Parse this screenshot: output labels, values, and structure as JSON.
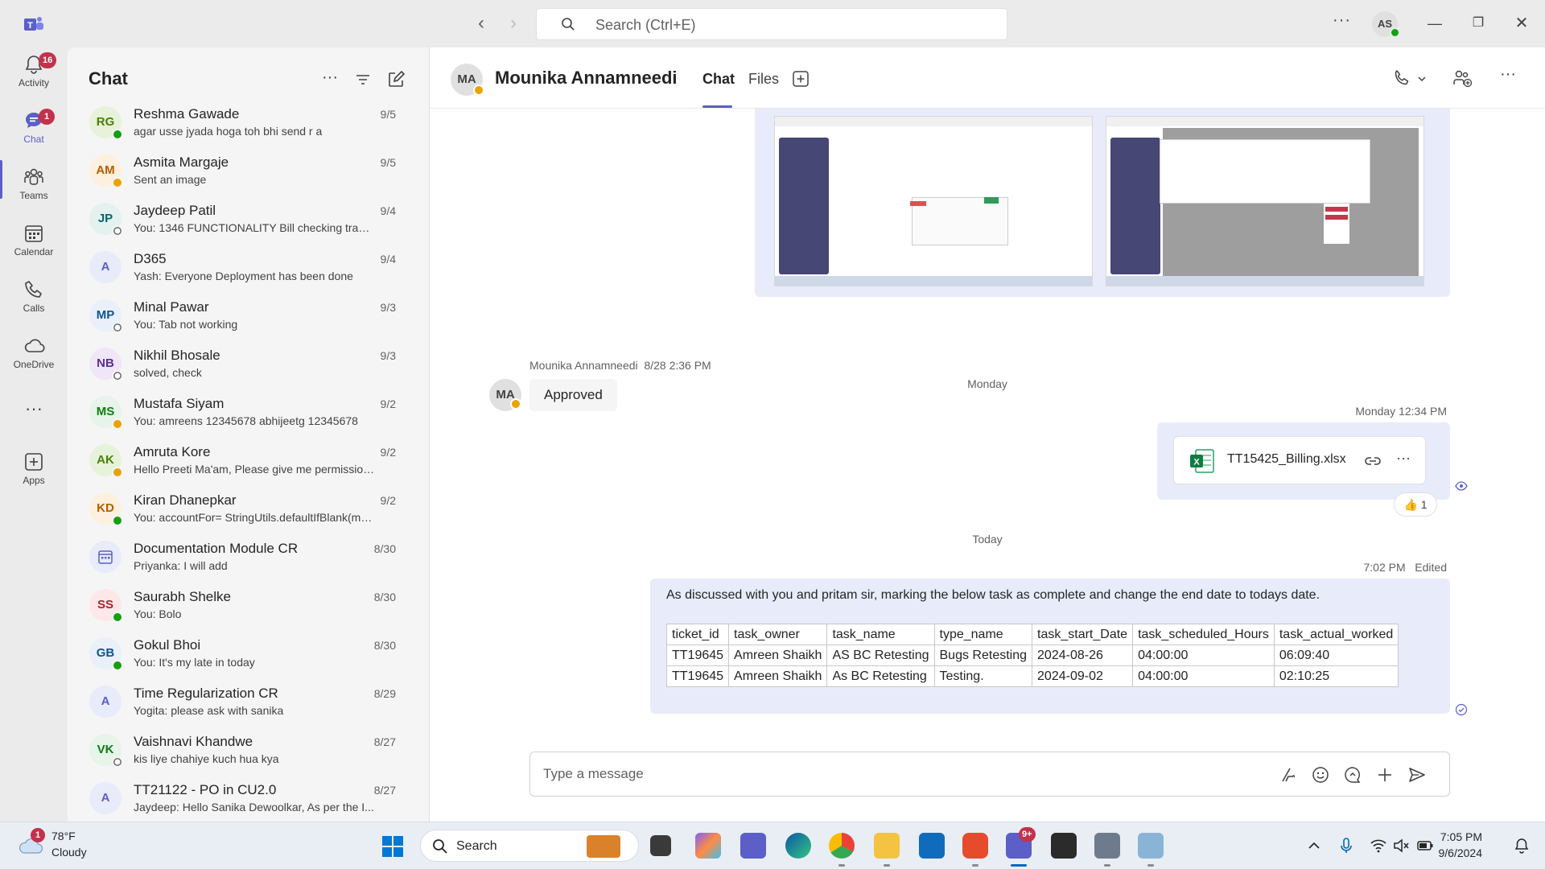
{
  "window": {
    "search_placeholder": "Search (Ctrl+E)",
    "user_initials": "AS"
  },
  "rail": {
    "items": [
      {
        "label": "Activity",
        "badge": "16"
      },
      {
        "label": "Chat",
        "badge": "1"
      },
      {
        "label": "Teams"
      },
      {
        "label": "Calendar"
      },
      {
        "label": "Calls"
      },
      {
        "label": "OneDrive"
      },
      {
        "label": "Apps"
      }
    ]
  },
  "chat_list": {
    "heading": "Chat",
    "items": [
      {
        "initials": "RG",
        "name": "Reshma Gawade",
        "preview": "agar usse jyada hoga toh bhi send r a",
        "date": "9/5",
        "status": "available"
      },
      {
        "initials": "AM",
        "name": "Asmita Margaje",
        "preview": "Sent an image",
        "date": "9/5",
        "status": "away"
      },
      {
        "initials": "JP",
        "name": "Jaydeep Patil",
        "preview": "You: 1346 FUNCTIONALITY Bill checking transa...",
        "date": "9/4",
        "status": "offline"
      },
      {
        "initials": "A",
        "name": "D365",
        "preview": "Yash: Everyone Deployment has been done",
        "date": "9/4",
        "status": "group"
      },
      {
        "initials": "MP",
        "name": "Minal Pawar",
        "preview": "You: Tab not working",
        "date": "9/3",
        "status": "offline"
      },
      {
        "initials": "NB",
        "name": "Nikhil Bhosale",
        "preview": "solved, check",
        "date": "9/3",
        "status": "offline"
      },
      {
        "initials": "MS",
        "name": "Mustafa Siyam",
        "preview": "You: amreens 12345678 abhijeetg 12345678",
        "date": "9/2",
        "status": "away"
      },
      {
        "initials": "AK",
        "name": "Amruta Kore",
        "preview": "Hello Preeti Ma'am, Please give me permission ...",
        "date": "9/2",
        "status": "away"
      },
      {
        "initials": "KD",
        "name": "Kiran Dhanepkar",
        "preview": "You: accountFor=  StringUtils.defaultIfBlank(ma...",
        "date": "9/2",
        "status": "available"
      },
      {
        "initials": "",
        "name": "Documentation Module CR",
        "preview": "Priyanka: I will add",
        "date": "8/30",
        "status": "meeting"
      },
      {
        "initials": "SS",
        "name": "Saurabh Shelke",
        "preview": "You: Bolo",
        "date": "8/30",
        "status": "available"
      },
      {
        "initials": "GB",
        "name": "Gokul Bhoi",
        "preview": "You: It's my late in today",
        "date": "8/30",
        "status": "available"
      },
      {
        "initials": "A",
        "name": "Time Regularization CR",
        "preview": "Yogita: please ask with sanika",
        "date": "8/29",
        "status": "group"
      },
      {
        "initials": "VK",
        "name": "Vaishnavi Khandwe",
        "preview": "kis liye chahiye kuch hua kya",
        "date": "8/27",
        "status": "offline"
      },
      {
        "initials": "A",
        "name": "TT21122 - PO in CU2.0",
        "preview": "Jaydeep: Hello Sanika Dewoolkar,   As per the I...",
        "date": "8/27",
        "status": "group"
      }
    ]
  },
  "conversation": {
    "initials": "MA",
    "name": "Mounika Annamneedi",
    "tabs": {
      "chat": "Chat",
      "files": "Files"
    },
    "msg1": {
      "sender": "Mounika Annamneedi",
      "time": "8/28 2:36 PM",
      "text": "Approved"
    },
    "day1": "Monday",
    "msg2": {
      "time": "Monday 12:34 PM",
      "file_name": "TT15425_Billing.xlsx",
      "reaction_count": "1"
    },
    "day2": "Today",
    "msg3": {
      "time": "7:02 PM",
      "edited": "Edited",
      "text": "As discussed with you and pritam sir, marking the below task as complete and change the end date to todays date.",
      "table": {
        "headers": [
          "ticket_id",
          "task_owner",
          "task_name",
          "type_name",
          "task_start_Date",
          "task_scheduled_Hours",
          "task_actual_worked"
        ],
        "rows": [
          [
            "TT19645",
            "Amreen Shaikh",
            "AS BC Retesting",
            "Bugs Retesting",
            "2024-08-26",
            "04:00:00",
            "06:09:40"
          ],
          [
            "TT19645",
            "Amreen Shaikh",
            "As BC Retesting",
            "Testing.",
            "2024-09-02",
            "04:00:00",
            "02:10:25"
          ]
        ]
      }
    },
    "compose_placeholder": "Type a message"
  },
  "taskbar": {
    "weather_temp": "78°F",
    "weather_cond": "Cloudy",
    "weather_badge": "1",
    "search_label": "Search",
    "teams_badge": "9+",
    "time": "7:05 PM",
    "date": "9/6/2024"
  },
  "colors": {
    "accent": "#5b5fc7",
    "available": "#13a10e",
    "away": "#eaa300",
    "bubble": "#e8ebfa"
  }
}
